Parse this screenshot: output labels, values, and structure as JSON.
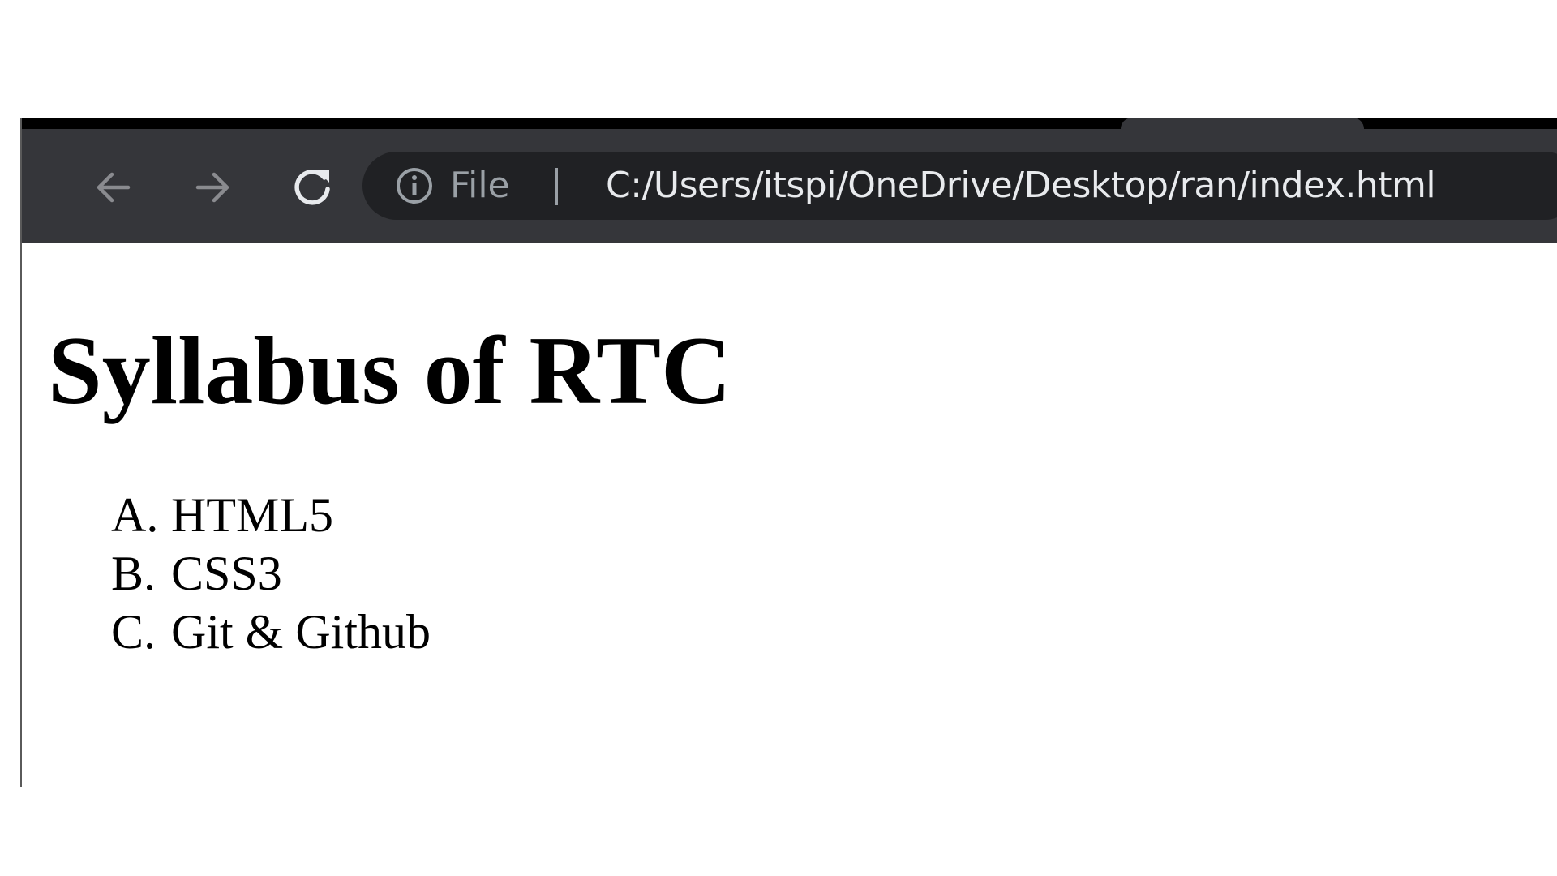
{
  "browser": {
    "address_bar": {
      "scheme_label": "File",
      "url": "C:/Users/itspi/OneDrive/Desktop/ran/index.html"
    },
    "icons": {
      "back": "arrow-left-icon",
      "forward": "arrow-right-icon",
      "reload": "reload-icon",
      "site_info": "info-icon"
    },
    "colors": {
      "toolbar": "#35363a",
      "omnibox": "#202124",
      "url_text": "#e8eaed",
      "muted_text": "#9aa0a6"
    }
  },
  "page": {
    "heading": "Syllabus of RTC",
    "list": [
      {
        "marker": "A.",
        "text": "HTML5"
      },
      {
        "marker": "B.",
        "text": "CSS3"
      },
      {
        "marker": "C.",
        "text": "Git & Github"
      }
    ]
  }
}
